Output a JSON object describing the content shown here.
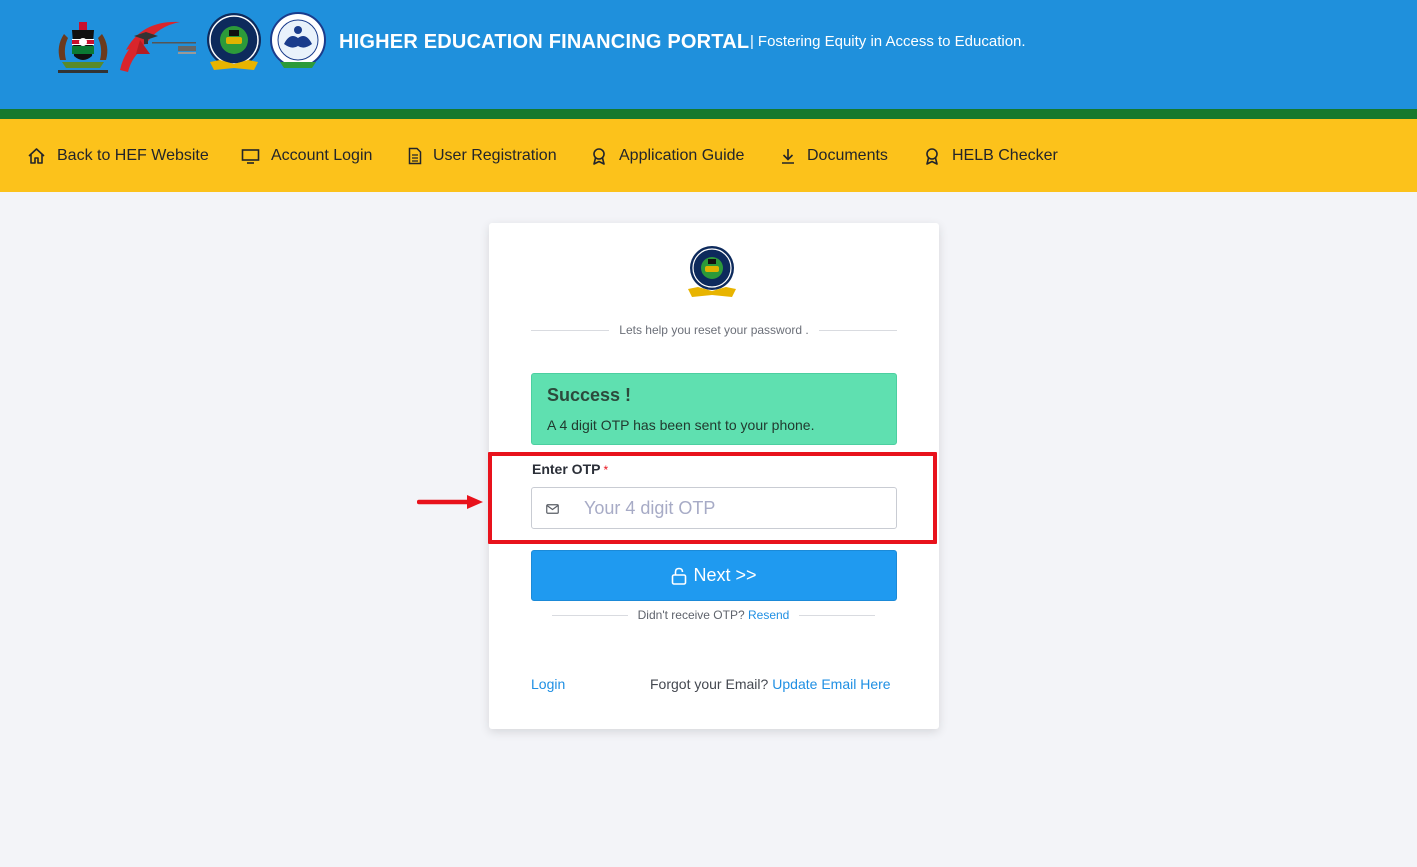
{
  "header": {
    "title": "HIGHER EDUCATION FINANCING PORTAL",
    "separator": "|",
    "tagline": "Fostering Equity in Access to Education.",
    "colors": {
      "header_bg": "#1f90dc",
      "stripe": "#15792d",
      "nav_bg": "#fcc21b"
    }
  },
  "nav": {
    "items": [
      {
        "label": "Back to HEF Website",
        "icon": "home-icon"
      },
      {
        "label": "Account Login",
        "icon": "monitor-icon"
      },
      {
        "label": "User Registration",
        "icon": "document-icon"
      },
      {
        "label": "Application Guide",
        "icon": "award-icon"
      },
      {
        "label": "Documents",
        "icon": "download-icon"
      },
      {
        "label": "HELB Checker",
        "icon": "award-icon"
      }
    ]
  },
  "card": {
    "subtitle": "Lets help you reset your password .",
    "alert": {
      "title": "Success !",
      "message": "A 4 digit OTP has been sent to your phone."
    },
    "otp": {
      "label": "Enter OTP",
      "required_mark": "*",
      "placeholder": "Your 4 digit OTP",
      "value": ""
    },
    "next_button": "Next >>",
    "resend": {
      "prompt": "Didn't receive OTP?",
      "link": "Resend"
    },
    "login_link": "Login",
    "forgot_email": {
      "prompt": "Forgot your Email?",
      "link": "Update Email Here"
    }
  }
}
